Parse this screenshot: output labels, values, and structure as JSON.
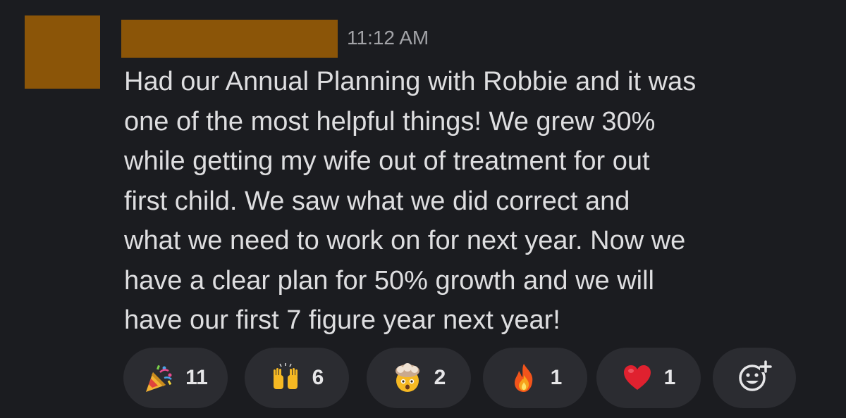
{
  "message": {
    "timestamp": "11:12 AM",
    "body_lines": [
      "Had our Annual Planning with Robbie and it was",
      "one of the most helpful things! We grew 30%",
      "while getting my wife out of treatment for out",
      "first child. We saw what we did correct and",
      "what we need to work on for next year. Now we",
      "have a clear plan for 50% growth and we will",
      "have our first 7 figure  year next year!"
    ]
  },
  "reactions": [
    {
      "emoji": "party-popper-icon",
      "count": "11"
    },
    {
      "emoji": "raising-hands-icon",
      "count": "6"
    },
    {
      "emoji": "exploding-head-icon",
      "count": "2"
    },
    {
      "emoji": "fire-icon",
      "count": "1"
    },
    {
      "emoji": "red-heart-icon",
      "count": "1"
    }
  ],
  "add_reaction": {
    "icon": "add-reaction-icon"
  },
  "colors": {
    "background": "#1b1c20",
    "redaction": "#8b5508",
    "pill": "#2b2c31",
    "text": "#dedee0",
    "muted": "#a2a3a7"
  }
}
